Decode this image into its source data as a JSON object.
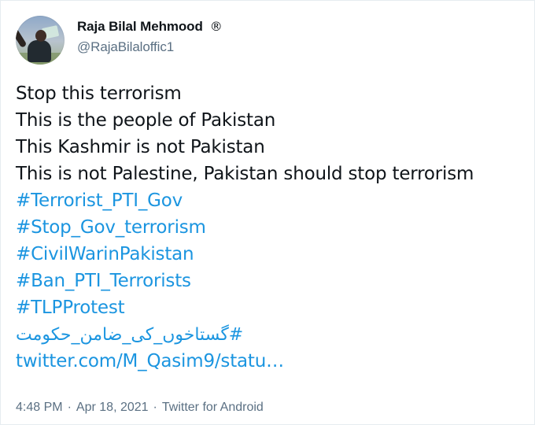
{
  "tweet": {
    "author": {
      "display_name": "Raja Bilal Mehmood",
      "registered_mark": "®",
      "handle": "@RajaBilaloffic1"
    },
    "text_lines": [
      "Stop this terrorism",
      " This is the people of Pakistan",
      " This Kashmir is not Pakistan",
      " This is not Palestine, Pakistan should stop terrorism"
    ],
    "hashtags": [
      "#Terrorist_PTI_Gov",
      "#Stop_Gov_terrorism",
      "#CivilWarinPakistan",
      "#Ban_PTI_Terrorists",
      "#TLPProtest",
      "#گستاخوں_کی_ضامن_حکومت"
    ],
    "link": "twitter.com/M_Qasim9/statu…",
    "time": "4:48 PM",
    "separator_1": "·",
    "date": "Apr 18, 2021",
    "separator_2": "·",
    "source": "Twitter for Android"
  },
  "colors": {
    "text": "#0f1419",
    "muted": "#5b7083",
    "link": "#1b95e0"
  }
}
